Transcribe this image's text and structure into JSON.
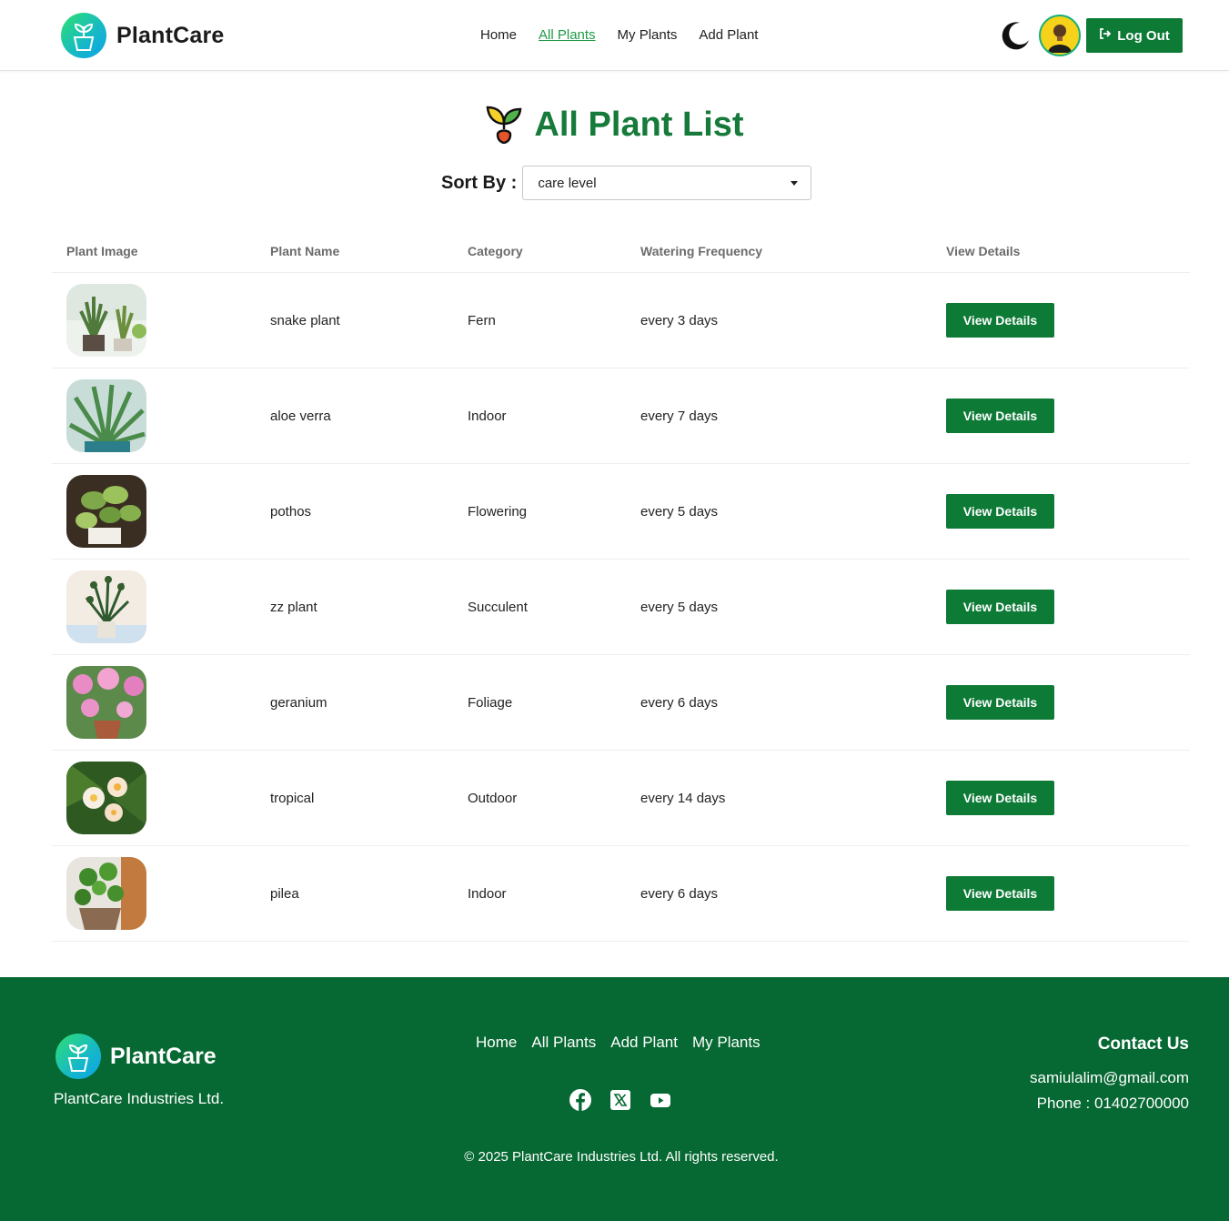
{
  "nav": {
    "brand": "PlantCare",
    "links": [
      {
        "label": "Home",
        "active": false
      },
      {
        "label": "All Plants",
        "active": true
      },
      {
        "label": "My Plants",
        "active": false
      },
      {
        "label": "Add Plant",
        "active": false
      }
    ],
    "logout_label": "Log Out"
  },
  "main": {
    "title": "All Plant List",
    "sort_label": "Sort By :",
    "sort_value": "care level"
  },
  "table": {
    "headers": [
      "Plant Image",
      "Plant Name",
      "Category",
      "Watering Frequency",
      "View Details"
    ],
    "button_label": "View Details",
    "rows": [
      {
        "name": "snake plant",
        "category": "Fern",
        "watering": "every 3 days"
      },
      {
        "name": "aloe verra",
        "category": "Indoor",
        "watering": "every 7 days"
      },
      {
        "name": "pothos",
        "category": "Flowering",
        "watering": "every 5 days"
      },
      {
        "name": "zz plant",
        "category": "Succulent",
        "watering": "every 5 days"
      },
      {
        "name": "geranium",
        "category": "Foliage",
        "watering": "every 6 days"
      },
      {
        "name": "tropical",
        "category": "Outdoor",
        "watering": "every 14 days"
      },
      {
        "name": "pilea",
        "category": "Indoor",
        "watering": "every 6 days"
      }
    ]
  },
  "footer": {
    "brand": "PlantCare",
    "company": "PlantCare Industries Ltd.",
    "links": [
      "Home",
      "All Plants",
      "Add Plant",
      "My Plants"
    ],
    "contact_title": "Contact Us",
    "email": "samiulalim@gmail.com",
    "phone": "Phone : 01402700000",
    "copyright": "© 2025 PlantCare Industries Ltd. All rights reserved."
  },
  "colors": {
    "primary": "#0d7a36",
    "footer_bg": "#066832",
    "title": "#157a3a",
    "active_link": "#1f9a46"
  }
}
